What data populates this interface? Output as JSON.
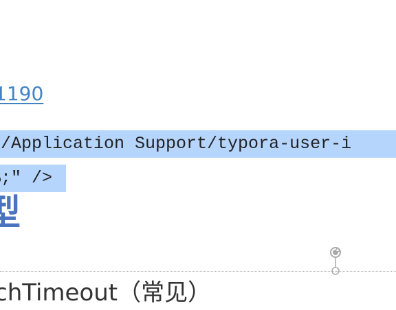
{
  "document": {
    "link_text": "1190",
    "code_line_1": "y/Application Support/typora-user-i",
    "code_line_2": "%;\" />",
    "heading_fragment": "型",
    "bottom_text": "chTimeout（常见）"
  },
  "colors": {
    "link": "#4183c4",
    "selection": "#b5d5fd",
    "heading": "#4a73c0",
    "text": "#333333",
    "divider": "#999999"
  },
  "icons": {
    "resize_handle": "rotate-handle-icon"
  }
}
